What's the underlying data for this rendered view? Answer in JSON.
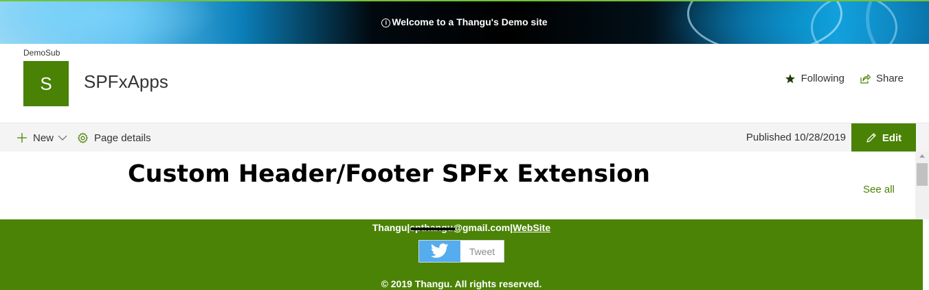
{
  "banner": {
    "info_symbol": "i",
    "text": "Welcome to a Thangu's Demo site"
  },
  "header": {
    "breadcrumb": "DemoSub",
    "logo_letter": "S",
    "site_title": "SPFxApps",
    "following_label": "Following",
    "share_label": "Share"
  },
  "command_bar": {
    "new_label": "New",
    "page_details_label": "Page details",
    "published_text": "Published 10/28/2019",
    "edit_label": "Edit"
  },
  "content": {
    "heading": "Custom Header/Footer SPFx Extension",
    "see_all_label": "See all"
  },
  "footer": {
    "name": "Thangu",
    "separator": "|",
    "email_visible": "spthangu@gmail.com",
    "website_label": "WebSite",
    "tweet_label": "Tweet",
    "copyright": "© 2019 Thangu. All rights reserved."
  },
  "colors": {
    "accent": "#498205",
    "footer_bg": "#4b8306",
    "twitter_blue": "#55acee"
  },
  "icons": {
    "banner": "info-icon",
    "following": "star-icon",
    "share": "share-icon",
    "new": "plus-icon",
    "new_menu": "chevron-down-icon",
    "page_details": "gear-icon",
    "edit": "pencil-icon",
    "tweet": "twitter-bird-icon"
  }
}
